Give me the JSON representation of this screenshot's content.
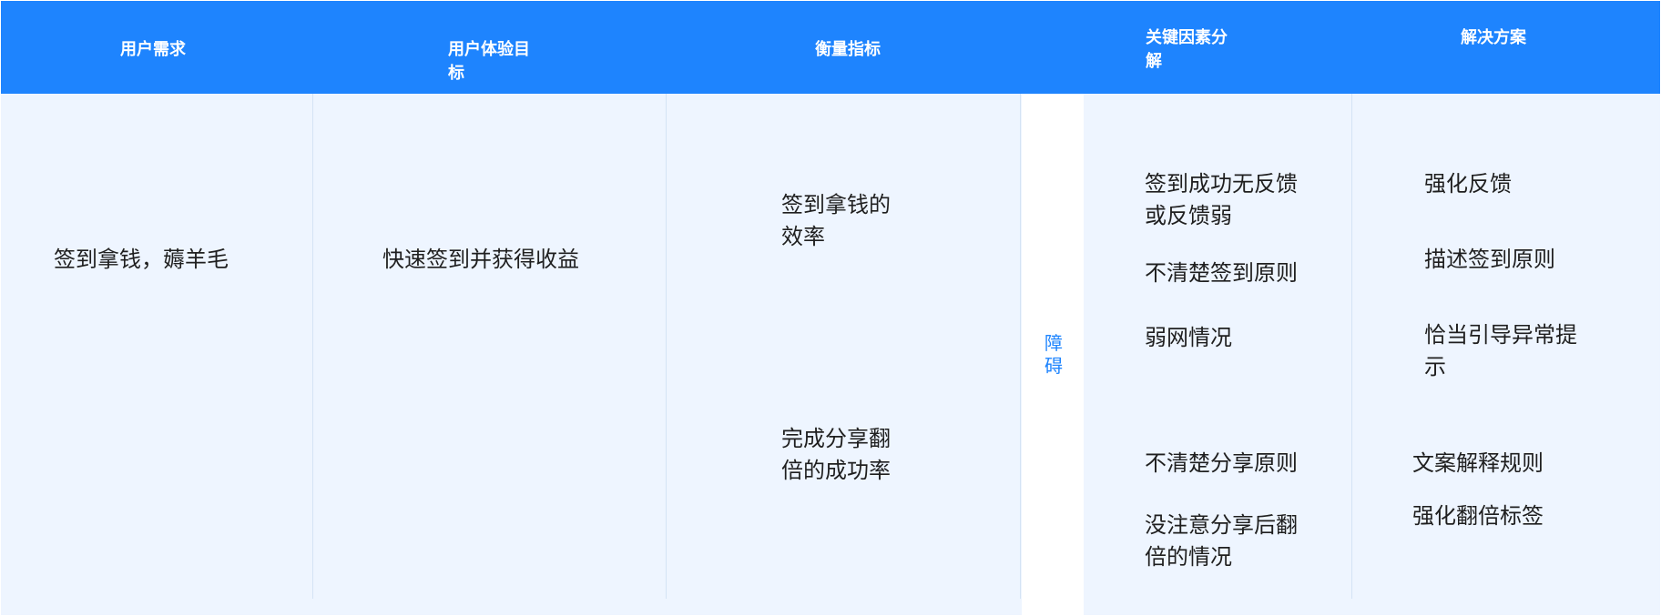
{
  "header": {
    "col1": "用户需求",
    "col2_line1": "用户体验目",
    "col2_line2": "标",
    "col3": "衡量指标",
    "col4_line1": "关键因素分",
    "col4_line2": "解",
    "col5": "解决方案"
  },
  "body": {
    "user_need": "签到拿钱，薅羊毛",
    "ux_goal": "快速签到并获得收益",
    "metric1_line1": "签到拿钱的",
    "metric1_line2": "效率",
    "metric2_line1": "完成分享翻",
    "metric2_line2": "倍的成功率",
    "obstacle_line1": "障",
    "obstacle_line2": "碍",
    "factors": [
      {
        "line1": "签到成功无反馈",
        "line2": "或反馈弱"
      },
      {
        "line1": "不清楚签到原则",
        "line2": ""
      },
      {
        "line1": "弱网情况",
        "line2": ""
      },
      {
        "line1": "不清楚分享原则",
        "line2": ""
      },
      {
        "line1": "没注意分享后翻",
        "line2": "倍的情况"
      }
    ],
    "solutions": [
      {
        "line1": "强化反馈",
        "line2": ""
      },
      {
        "line1": "描述签到原则",
        "line2": ""
      },
      {
        "line1": "恰当引导异常提",
        "line2": "示"
      },
      {
        "line1": "文案解释规则",
        "line2": ""
      },
      {
        "line1": "强化翻倍标签",
        "line2": ""
      }
    ]
  },
  "colors": {
    "header_bg": "#1e84fe",
    "panel_bg": "#eef5ff",
    "accent_text": "#1e84fe"
  }
}
